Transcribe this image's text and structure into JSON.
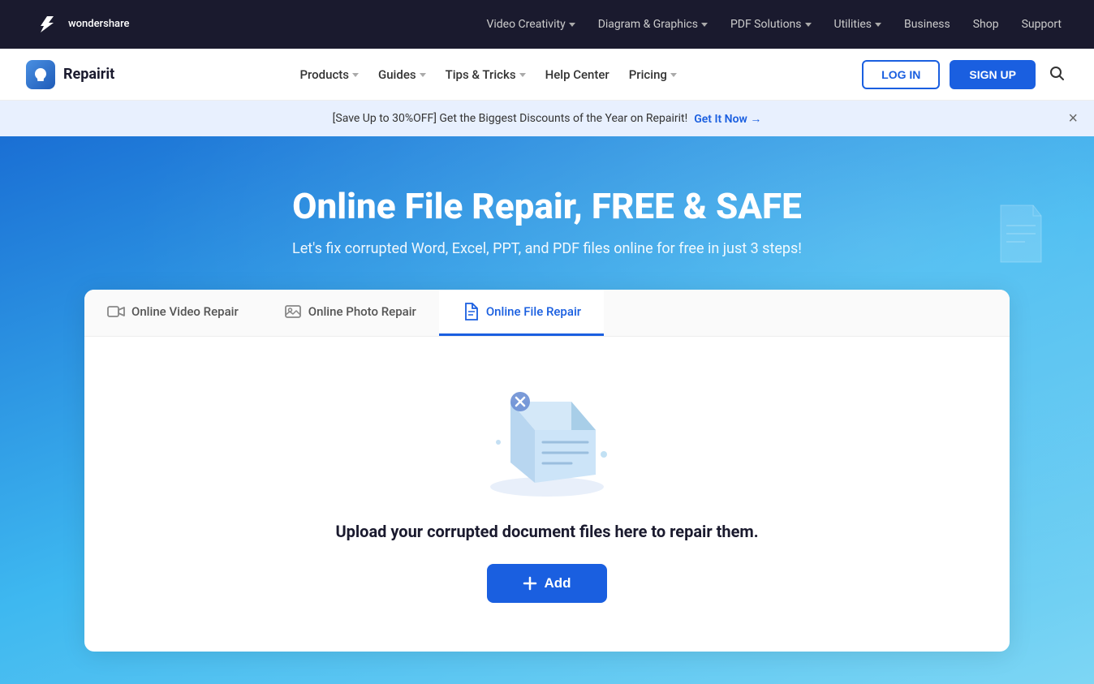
{
  "topNav": {
    "brand": "wondershare",
    "links": [
      {
        "label": "Video Creativity",
        "hasDropdown": true
      },
      {
        "label": "Diagram & Graphics",
        "hasDropdown": true
      },
      {
        "label": "PDF Solutions",
        "hasDropdown": true
      },
      {
        "label": "Utilities",
        "hasDropdown": true
      },
      {
        "label": "Business"
      },
      {
        "label": "Shop"
      },
      {
        "label": "Support"
      }
    ]
  },
  "secondNav": {
    "brand": "Repairit",
    "links": [
      {
        "label": "Products",
        "hasDropdown": true
      },
      {
        "label": "Guides",
        "hasDropdown": true
      },
      {
        "label": "Tips & Tricks",
        "hasDropdown": true
      },
      {
        "label": "Help Center"
      },
      {
        "label": "Pricing",
        "hasDropdown": true
      }
    ],
    "loginLabel": "LOG IN",
    "signupLabel": "SIGN UP"
  },
  "banner": {
    "text": "[Save Up to 30%OFF] Get the Biggest Discounts of the Year on Repairit!",
    "linkText": "Get It Now →"
  },
  "hero": {
    "title": "Online File Repair, FREE & SAFE",
    "subtitle": "Let's fix corrupted Word, Excel, PPT, and PDF files online for free in just 3 steps!"
  },
  "card": {
    "tabs": [
      {
        "id": "video",
        "label": "Online Video Repair",
        "active": false
      },
      {
        "id": "photo",
        "label": "Online Photo Repair",
        "active": false
      },
      {
        "id": "file",
        "label": "Online File Repair",
        "active": true
      }
    ],
    "uploadText": "Upload your corrupted document files here to repair them.",
    "addButtonLabel": "+ Add"
  }
}
